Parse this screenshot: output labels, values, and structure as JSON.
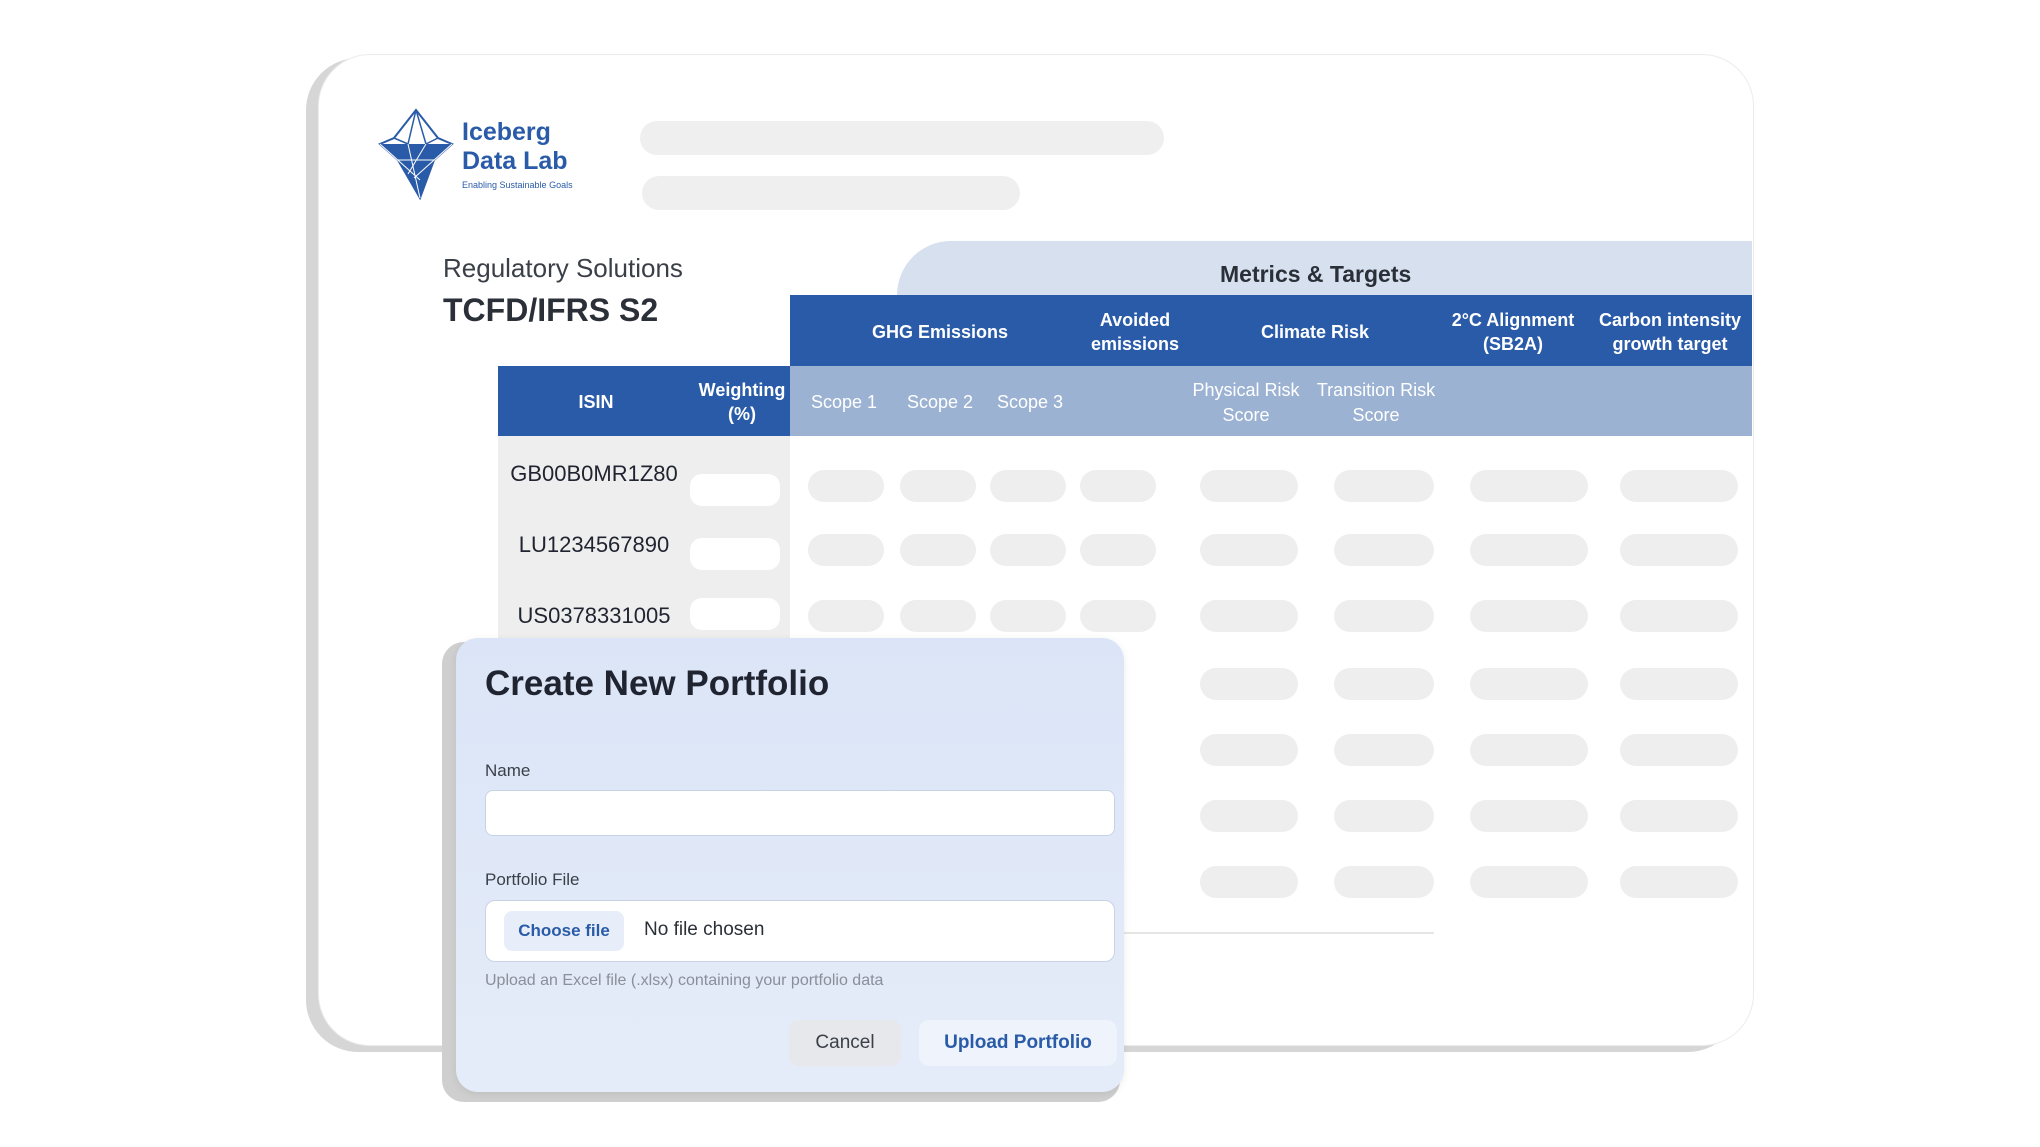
{
  "brand": {
    "name": "Iceberg\nData Lab",
    "tagline": "Enabling Sustainable Goals",
    "color": "#2a5ba8"
  },
  "page": {
    "subtitle": "Regulatory Solutions",
    "title": "TCFD/IFRS S2"
  },
  "table": {
    "section_label": "Metrics & Targets",
    "groups": [
      "GHG Emissions",
      "Avoided emissions",
      "Climate Risk",
      "2°C Alignment (SB2A)",
      "Carbon intensity growth target"
    ],
    "isin_header": "ISIN",
    "weighting_header": "Weighting (%)",
    "subheaders": [
      "Scope 1",
      "Scope 2",
      "Scope 3",
      "Physical Risk Score",
      "Transition Risk Score"
    ],
    "rows": [
      "GB00B0MR1Z80",
      "LU1234567890",
      "US0378331005"
    ]
  },
  "modal": {
    "title": "Create New Portfolio",
    "name_label": "Name",
    "name_value": "",
    "file_label": "Portfolio File",
    "choose_file": "Choose file",
    "no_file": "No file chosen",
    "hint": "Upload an Excel file (.xlsx) containing your portfolio data",
    "cancel": "Cancel",
    "upload": "Upload Portfolio"
  }
}
